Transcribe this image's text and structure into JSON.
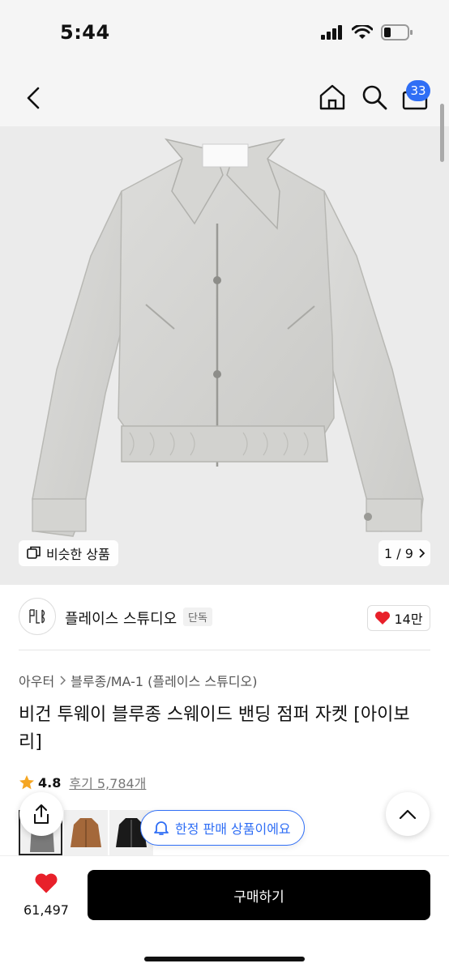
{
  "status": {
    "time": "5:44"
  },
  "header": {
    "cart_count": "33"
  },
  "gallery": {
    "similar_label": "비슷한 상품",
    "page": "1 / 9"
  },
  "brand": {
    "name": "플레이스 스튜디오",
    "tag": "단독",
    "logo_text": "PLSTD",
    "likes": "14만"
  },
  "breadcrumb": {
    "items": [
      "아우터",
      "블루종/MA-1 (플레이스 스튜디오)"
    ]
  },
  "product": {
    "title": "비건 투웨이 블루종 스웨이드 밴딩 점퍼 자켓 [아이보리]",
    "rating": "4.8",
    "reviews": "후기 5,784개"
  },
  "toast": {
    "text": "한정 판매 상품이에요"
  },
  "bottom": {
    "like_count": "61,497",
    "buy_label": "구매하기"
  },
  "colors": {
    "accent": "#2f6ef5",
    "heart": "#e8202a",
    "star": "#f5a623"
  }
}
